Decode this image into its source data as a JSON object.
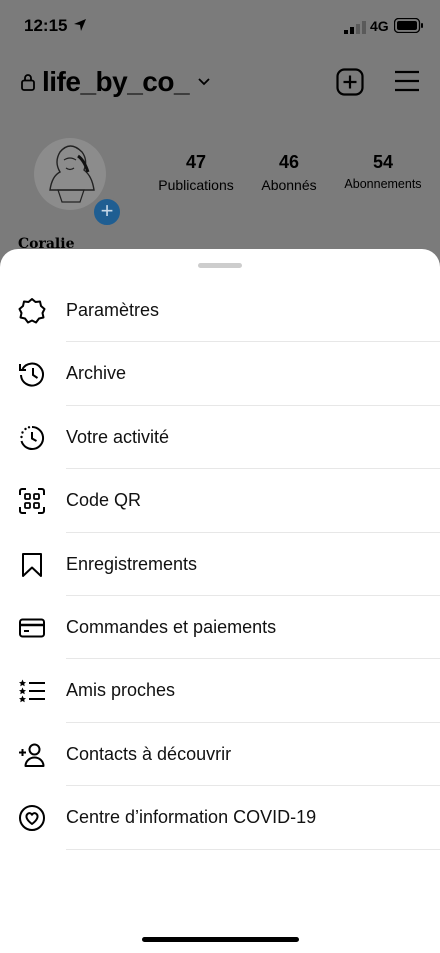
{
  "status_bar": {
    "time": "12:15",
    "network": "4G"
  },
  "profile": {
    "username": "life_by_co_",
    "stats": [
      {
        "value": "47",
        "label": "Publications"
      },
      {
        "value": "46",
        "label": "Abonnés"
      },
      {
        "value": "54",
        "label": "Abonnements"
      }
    ],
    "display_name": "Coralie"
  },
  "sheet_menu": [
    {
      "label": "Paramètres",
      "icon": "settings-gear-icon"
    },
    {
      "label": "Archive",
      "icon": "archive-clock-icon"
    },
    {
      "label": "Votre activité",
      "icon": "activity-icon"
    },
    {
      "label": "Code QR",
      "icon": "qr-code-icon"
    },
    {
      "label": "Enregistrements",
      "icon": "bookmark-icon"
    },
    {
      "label": "Commandes et paiements",
      "icon": "credit-card-icon"
    },
    {
      "label": "Amis proches",
      "icon": "close-friends-list-icon"
    },
    {
      "label": "Contacts à découvrir",
      "icon": "add-person-icon"
    },
    {
      "label": "Centre d’information COVID-19",
      "icon": "covid-heart-icon"
    }
  ]
}
